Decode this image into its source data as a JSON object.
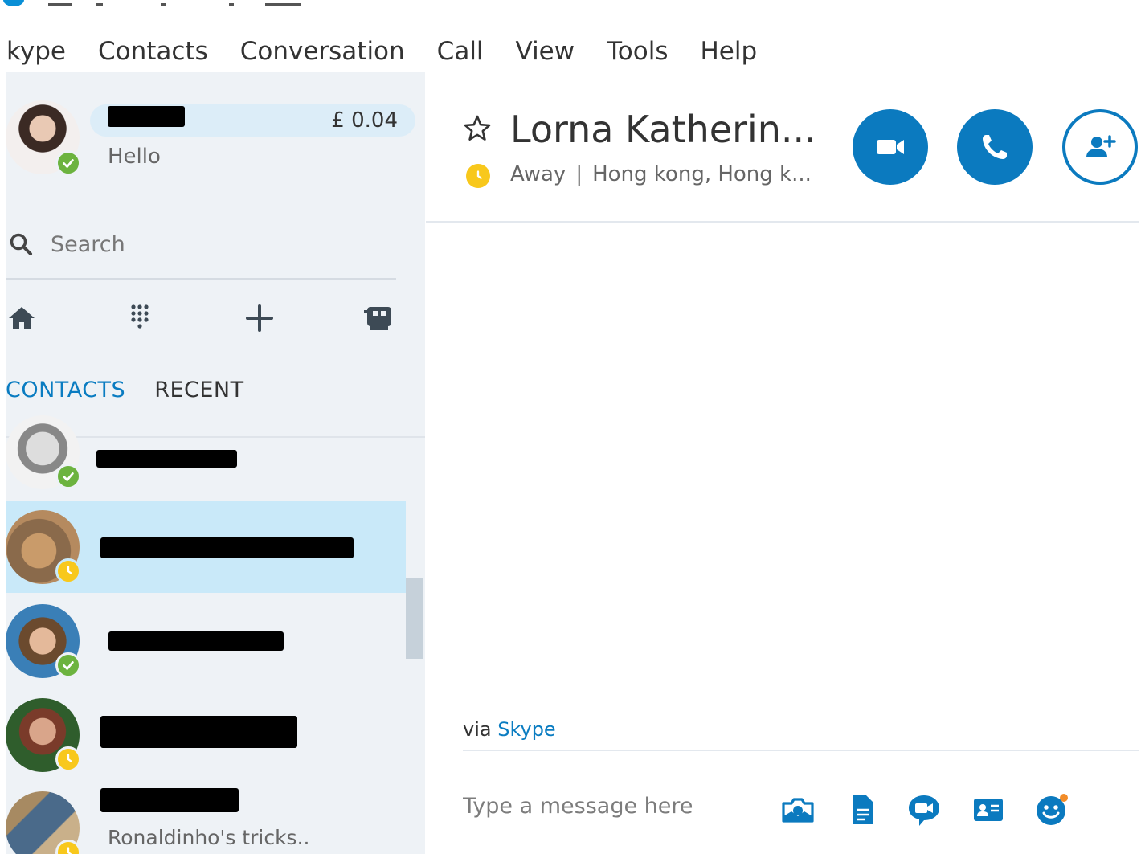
{
  "menu": {
    "items": [
      "kype",
      "Contacts",
      "Conversation",
      "Call",
      "View",
      "Tools",
      "Help"
    ]
  },
  "profile": {
    "credit": "£ 0.04",
    "mood": "Hello",
    "status": "online"
  },
  "search": {
    "placeholder": "Search"
  },
  "nav": {
    "icons": [
      "home-icon",
      "dialpad-icon",
      "add-icon",
      "contacts-book-icon"
    ]
  },
  "tabs": {
    "contacts": "CONTACTS",
    "recent": "RECENT"
  },
  "contacts": [
    {
      "status": "online",
      "subtitle": ""
    },
    {
      "status": "away",
      "subtitle": "",
      "selected": true
    },
    {
      "status": "online",
      "subtitle": ""
    },
    {
      "status": "away",
      "subtitle": ""
    },
    {
      "status": "away",
      "subtitle": "Ronaldinho's tricks.."
    }
  ],
  "conversation": {
    "name": "Lorna Katherin...",
    "status": "Away",
    "location": "Hong kong, Hong k...",
    "via_prefix": "via",
    "via_link": "Skype",
    "compose_placeholder": "Type a message here"
  },
  "colors": {
    "accent": "#0b7abf",
    "online": "#6cb33f",
    "away": "#f8c81c",
    "selected_row": "#c9e9f9",
    "sidebar_bg": "#eef2f6"
  }
}
